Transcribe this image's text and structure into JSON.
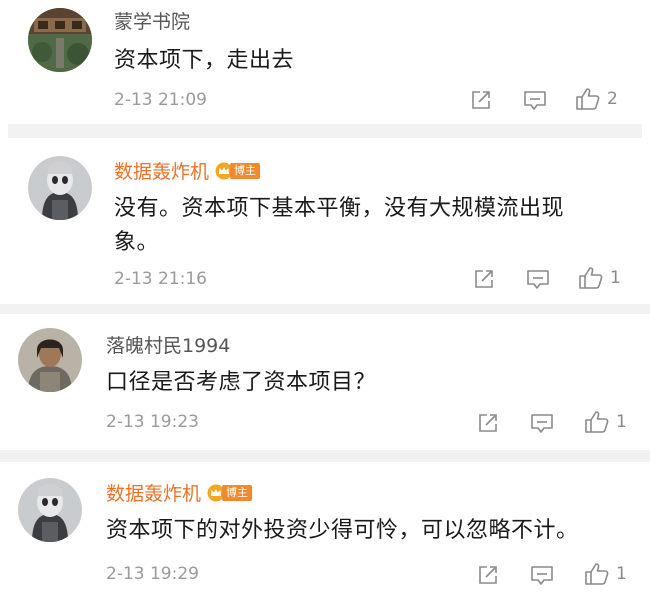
{
  "comments": [
    {
      "user": "蒙学书院",
      "text": "资本项下，走出去",
      "time": "2-13 21:09",
      "likes": "2",
      "badge": ""
    },
    {
      "user": "数据轰炸机",
      "text": "没有。资本项下基本平衡，没有大规模流出现象。",
      "time": "2-13 21:16",
      "likes": "1",
      "badge": "博主"
    },
    {
      "user": "落魄村民1994",
      "text": "口径是否考虑了资本项目？",
      "time": "2-13 19:23",
      "likes": "1",
      "badge": ""
    },
    {
      "user": "数据轰炸机",
      "text": "资本项下的对外投资少得可怜，可以忽略不计。",
      "time": "2-13 19:29",
      "likes": "1",
      "badge": "博主"
    }
  ],
  "icons": {
    "share": "share-icon",
    "comment": "comment-icon",
    "like": "thumbs-up-icon",
    "crown": "crown-icon"
  },
  "colors": {
    "author_name": "#e8742a",
    "badge_bg": "#f08a2c",
    "normal_name": "#555555",
    "divider": "#f2f2f2",
    "meta": "#9a9a9a"
  }
}
